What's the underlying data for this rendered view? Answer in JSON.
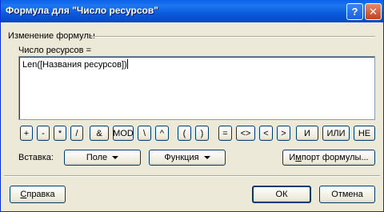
{
  "window": {
    "title": "Формула для \"Число ресурсов\""
  },
  "titlebar": {
    "help_symbol": "?",
    "close_symbol": "✕"
  },
  "group": {
    "label": "Изменение формулы"
  },
  "expression": {
    "label": "Число ресурсов =",
    "value": "Len([Названия ресурсов])"
  },
  "operators": [
    "+",
    "-",
    "*",
    "/",
    "&",
    "MOD",
    "\\",
    "^",
    "(",
    ")",
    "=",
    "<>",
    "<",
    ">",
    "И",
    "ИЛИ",
    "НЕ"
  ],
  "insert": {
    "label": "Вставка:",
    "field_label": "Поле",
    "function_label": "Функция",
    "import_label_u": "м",
    "import_label_pre": "И",
    "import_label_post": "порт формулы..."
  },
  "footer": {
    "help_u": "С",
    "help_rest": "правка",
    "ok_label": "ОК",
    "cancel_label": "Отмена"
  }
}
